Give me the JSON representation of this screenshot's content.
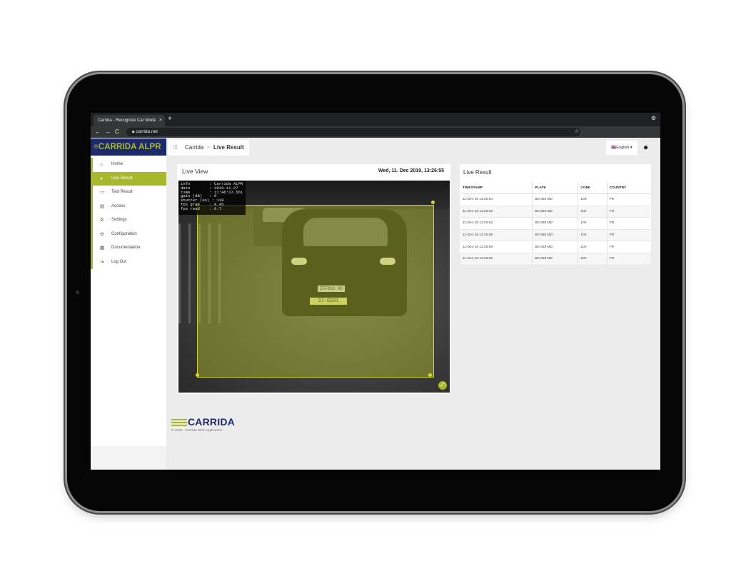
{
  "browser": {
    "tab_title": "Carrida - Recognize Car Mode",
    "tab_close": "×",
    "new_tab": "+",
    "back": "←",
    "forward": "→",
    "reload": "C",
    "url": "carrida.net",
    "bookmark_star": "☆",
    "menu_icon": "⚙"
  },
  "sidebar": {
    "logo": "≡CARRIDA ALPR",
    "items": [
      {
        "label": "Home",
        "icon": "⌂"
      },
      {
        "label": "Live Result",
        "icon": "●"
      },
      {
        "label": "Text Result",
        "icon": "▭"
      },
      {
        "label": "Access",
        "icon": "▤"
      },
      {
        "label": "Settings",
        "icon": "✲"
      },
      {
        "label": "Configuration",
        "icon": "⚙"
      },
      {
        "label": "Documentation",
        "icon": "▦"
      },
      {
        "label": "Log Out",
        "icon": "⇥"
      }
    ]
  },
  "header": {
    "grid_icon": "⁞⁞⁞",
    "breadcrumb_root": "Carrida",
    "breadcrumb_sep": ">",
    "breadcrumb_current": "Live Result",
    "language": "🇬🇧English ▾",
    "user_icon": "●"
  },
  "live_view": {
    "title": "Live View",
    "datetime": "Wed, 11. Dec 2019, 13:26:55",
    "overlay": "info        : Carrida ALPR\ndate        : 2019-11-27\ntime        : 11:46:37.561\ngain (dB)   : 0\nshutter (us) : 118\nfps grab    : 9.45\nfps read    : 6.7",
    "plate_top": "ZFF818 AS",
    "plate_bottom": "3J-GS91",
    "fullscreen_icon": "⤢"
  },
  "live_result": {
    "title": "Live Result",
    "columns": [
      "TIMESTAMP",
      "PLATE",
      "CONF",
      "COUNTRY"
    ],
    "rows": [
      [
        "11-Dec-19 13:26:54",
        "BS 058 MD",
        "100",
        "FR"
      ],
      [
        "11-Dec-19 13:26:53",
        "BS 058 MD",
        "100",
        "FR"
      ],
      [
        "11-Dec-19 13:26:53",
        "BS 058 MD",
        "100",
        "FR"
      ],
      [
        "11-Dec-19 13:26:59",
        "BS 058 MD",
        "100",
        "FR"
      ],
      [
        "11-Dec-19 13:26:59",
        "BS 058 MD",
        "100",
        "FR"
      ],
      [
        "11-Dec-19 13:26:56",
        "BS 058 MD",
        "100",
        "FR"
      ]
    ]
  },
  "footer": {
    "logo": "CARRIDA",
    "copyright": "© 2019 - Carrida Web Application"
  }
}
